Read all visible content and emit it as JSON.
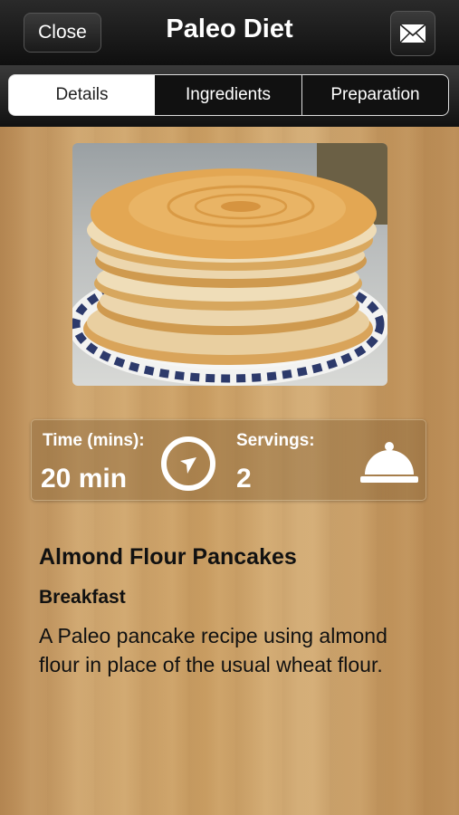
{
  "header": {
    "close_label": "Close",
    "title": "Paleo Diet",
    "mail_icon": "envelope-icon"
  },
  "tabs": [
    {
      "label": "Details",
      "selected": true
    },
    {
      "label": "Ingredients",
      "selected": false
    },
    {
      "label": "Preparation",
      "selected": false
    }
  ],
  "recipe": {
    "image_icon": "pancake-stack-photo",
    "time_label": "Time (mins):",
    "time_value": "20 min",
    "time_icon": "clock-icon",
    "servings_label": "Servings:",
    "servings_value": "2",
    "servings_icon": "serving-cloche-icon",
    "name": "Almond Flour Pancakes",
    "category": "Breakfast",
    "description": "A Paleo pancake recipe using almond flour in place of the usual wheat flour."
  },
  "colors": {
    "navbar": "#111111",
    "wood": "#c8a16b",
    "text": "#111111"
  }
}
